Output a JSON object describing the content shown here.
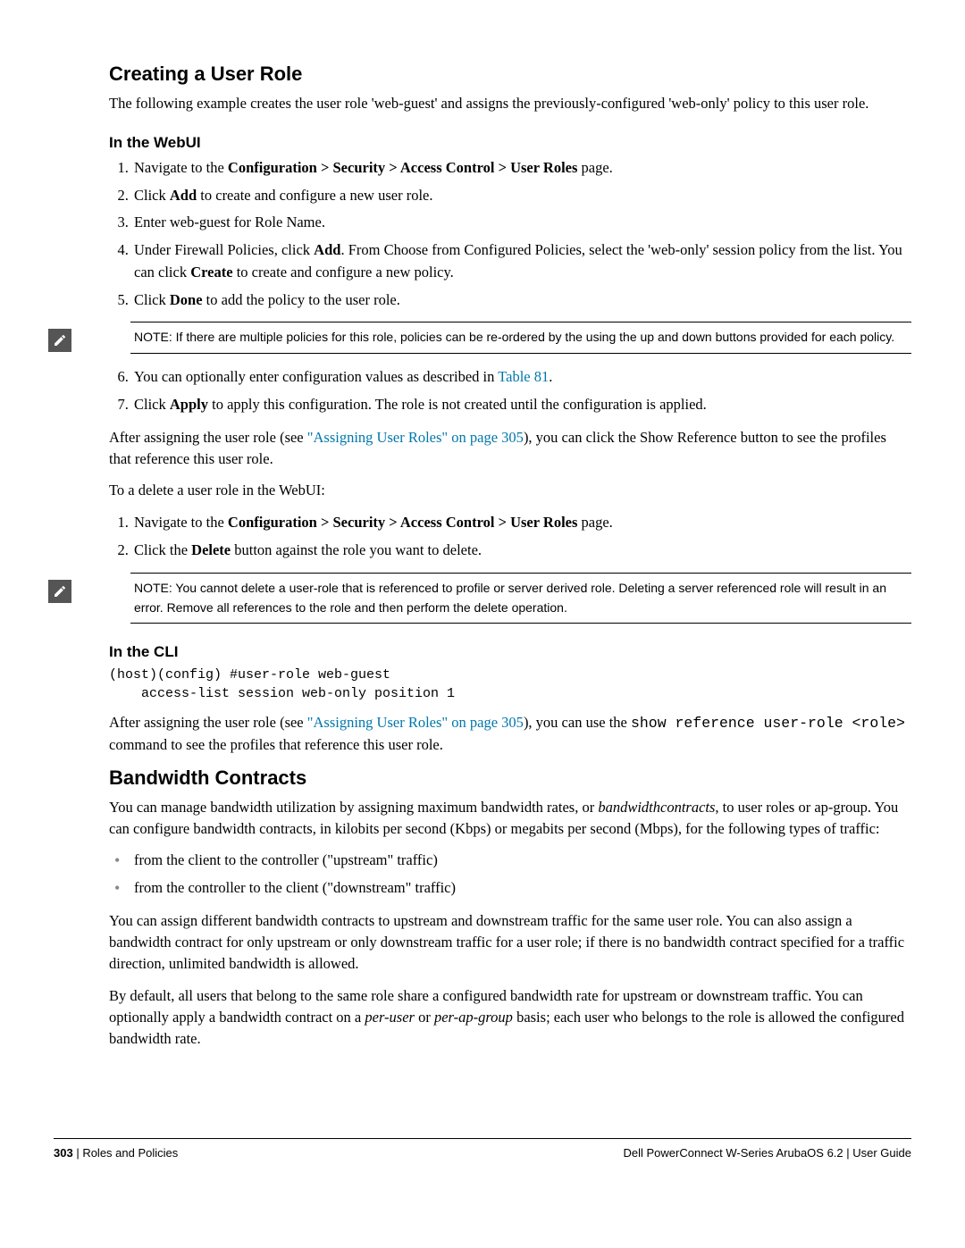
{
  "section1": {
    "title": "Creating a User Role",
    "intro": "The following example creates the user role 'web-guest' and assigns the previously-configured 'web-only' policy to this user role.",
    "webui_heading": "In the WebUI",
    "steps_a": {
      "s1_pre": "Navigate to the ",
      "s1_bold": "Configuration > Security > Access Control > User Roles",
      "s1_post": " page.",
      "s2_pre": "Click ",
      "s2_bold": "Add",
      "s2_post": " to create and configure a new user role.",
      "s3": "Enter web-guest for Role Name.",
      "s4_pre": "Under Firewall Policies, click ",
      "s4_bold1": "Add",
      "s4_mid": ". From Choose from Configured Policies, select the 'web-only' session policy from the list. You can click ",
      "s4_bold2": "Create",
      "s4_post": " to create and configure a new policy.",
      "s5_pre": "Click ",
      "s5_bold": "Done",
      "s5_post": " to add the policy to the user role."
    },
    "note1": "NOTE: If there are multiple policies for this role, policies can be re-ordered by the using the up and down buttons provided for each policy.",
    "steps_b": {
      "s6_pre": "You can optionally enter configuration values as described in ",
      "s6_link": "Table 81",
      "s6_post": ".",
      "s7_pre": "Click ",
      "s7_bold": "Apply",
      "s7_post": " to apply this configuration. The role is not created until the configuration is applied."
    },
    "after_assign_pre": "After assigning the user role (see ",
    "after_assign_link": "\"Assigning User Roles\" on page 305",
    "after_assign_post": "), you can click the Show Reference button to see the profiles that reference this user role.",
    "delete_intro": "To a delete a user role in the WebUI:",
    "steps_c": {
      "s1_pre": "Navigate to the ",
      "s1_bold": "Configuration > Security > Access Control > User Roles",
      "s1_post": " page.",
      "s2_pre": "Click the ",
      "s2_bold": "Delete",
      "s2_post": " button against the role you want to delete."
    },
    "note2": "NOTE: You cannot delete a user-role that is referenced to profile or server derived role. Deleting a server referenced role will result in an error. Remove all references to the role and then perform the delete operation.",
    "cli_heading": "In the CLI",
    "cli_code": "(host)(config) #user-role web-guest\n    access-list session web-only position 1",
    "cli_after_pre": "After assigning the user role (see ",
    "cli_after_link": "\"Assigning User Roles\" on page 305",
    "cli_after_mid": "), you can use the ",
    "cli_after_mono": "show reference user-role <role>",
    "cli_after_post": " command to see the profiles that reference this user role."
  },
  "section2": {
    "title": "Bandwidth Contracts",
    "p1_pre": "You can manage bandwidth utilization by assigning maximum bandwidth rates, or ",
    "p1_em": "bandwidthcontracts",
    "p1_post": ", to user roles or ap-group. You can configure bandwidth contracts, in kilobits per second (Kbps) or megabits per second (Mbps), for the following types of traffic:",
    "bullets": {
      "b1": "from the client to the controller (\"upstream\" traffic)",
      "b2": "from the controller to the client (\"downstream\" traffic)"
    },
    "p2": "You can assign different bandwidth contracts to upstream and downstream traffic for the same user role. You can also assign a bandwidth contract for only upstream or only downstream traffic for a user role; if there is no bandwidth contract specified for a traffic direction, unlimited bandwidth is allowed.",
    "p3_pre": "By default, all users that belong to the same role share a configured bandwidth rate for upstream or downstream traffic. You can optionally apply a bandwidth contract on a ",
    "p3_em1": "per-user",
    "p3_mid": " or ",
    "p3_em2": "per-ap-group",
    "p3_post": " basis; each user who belongs to the role is allowed the configured bandwidth rate."
  },
  "footer": {
    "page_num": "303",
    "left_text": "Roles and Policies",
    "right_text": "Dell PowerConnect W-Series ArubaOS 6.2  |  User Guide"
  }
}
